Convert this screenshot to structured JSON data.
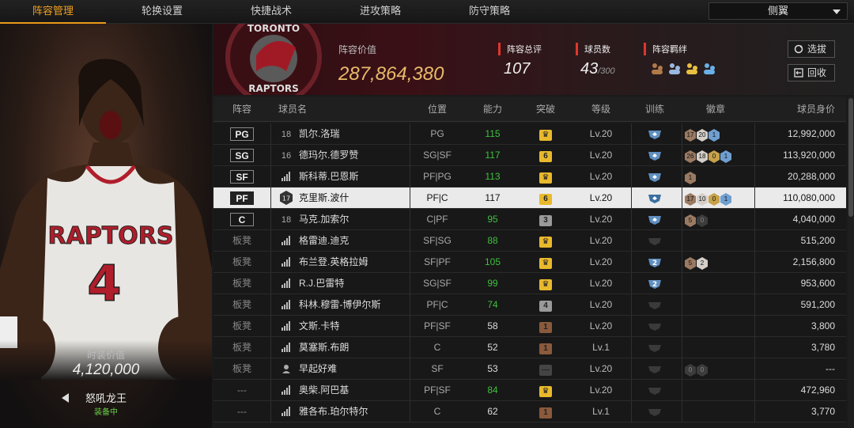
{
  "tabs": [
    "阵容管理",
    "轮换设置",
    "快捷战术",
    "进攻策略",
    "防守策略"
  ],
  "view_select": "侧翼",
  "left_panel": {
    "jersey_team": "RAPTORS",
    "jersey_number": "4",
    "value_label": "时装价值",
    "value": "4,120,000",
    "skin_name": "怒吼龙王",
    "skin_status": "装备中"
  },
  "header": {
    "logo_text_top": "TORONTO",
    "logo_text_bottom": "RAPTORS",
    "lineup_value_label": "阵容价值",
    "lineup_value": "287,864,380",
    "total_rating_label": "阵容总评",
    "total_rating": "107",
    "players_label": "球员数",
    "players_count": "43",
    "players_max": "/300",
    "bond_label": "阵容羁绊",
    "select_button": "选拔",
    "recycle_button": "回收"
  },
  "columns": [
    "阵容",
    "球员名",
    "位置",
    "能力",
    "突破",
    "等级",
    "训练",
    "徽章",
    "球员身价"
  ],
  "rows": [
    {
      "slot": "PG",
      "slot_type": "badge",
      "rank": "18",
      "name": "凯尔.洛瑞",
      "position": "PG",
      "ability": "115",
      "ability_color": "green",
      "breakthrough": "♛",
      "brk_color": "gold",
      "level": "Lv.20",
      "training": "shield",
      "badges": [
        {
          "t": "17",
          "c": "b-brz"
        },
        {
          "t": "20",
          "c": "b-lt"
        },
        {
          "t": "1",
          "c": "b-blue"
        }
      ],
      "value": "12,992,000"
    },
    {
      "slot": "SG",
      "slot_type": "badge",
      "rank": "16",
      "name": "德玛尔.德罗赞",
      "position": "SG|SF",
      "ability": "117",
      "ability_color": "green",
      "breakthrough": "6",
      "brk_color": "gold",
      "level": "Lv.20",
      "training": "shield",
      "badges": [
        {
          "t": "26",
          "c": "b-brz"
        },
        {
          "t": "18",
          "c": "b-lt"
        },
        {
          "t": "0",
          "c": "b-gold"
        },
        {
          "t": "1",
          "c": "b-blue"
        }
      ],
      "value": "113,920,000"
    },
    {
      "slot": "SF",
      "slot_type": "badge",
      "rank": "",
      "name": "斯科蒂.巴恩斯",
      "position": "PF|PG",
      "ability": "113",
      "ability_color": "green",
      "breakthrough": "♛",
      "brk_color": "gold",
      "level": "Lv.20",
      "training": "shield",
      "badges": [
        {
          "t": "1",
          "c": "b-brz"
        }
      ],
      "value": "20,288,000"
    },
    {
      "slot": "PF",
      "slot_type": "badge",
      "rank": "17",
      "name": "克里斯.波什",
      "position": "PF|C",
      "ability": "117",
      "ability_color": "white",
      "breakthrough": "6",
      "brk_color": "gold",
      "level": "Lv.20",
      "training": "shield",
      "badges": [
        {
          "t": "17",
          "c": "b-brz"
        },
        {
          "t": "10",
          "c": "b-lt"
        },
        {
          "t": "0",
          "c": "b-gold"
        },
        {
          "t": "1",
          "c": "b-blue"
        }
      ],
      "value": "110,080,000",
      "selected": true
    },
    {
      "slot": "C",
      "slot_type": "badge",
      "rank": "18",
      "name": "马克.加索尔",
      "position": "C|PF",
      "ability": "95",
      "ability_color": "green",
      "breakthrough": "3",
      "brk_color": "grey",
      "level": "Lv.20",
      "training": "shield",
      "badges": [
        {
          "t": "5",
          "c": "b-brz"
        },
        {
          "t": "0",
          "c": "b-dark"
        }
      ],
      "value": "4,040,000"
    },
    {
      "slot": "板凳",
      "slot_type": "text",
      "rank": "",
      "name": "格雷迪.迪克",
      "position": "SF|SG",
      "ability": "88",
      "ability_color": "green",
      "breakthrough": "♛",
      "brk_color": "gold",
      "level": "Lv.20",
      "training": "dim",
      "badges": [],
      "value": "515,200"
    },
    {
      "slot": "板凳",
      "slot_type": "text",
      "rank": "",
      "name": "布兰登.英格拉姆",
      "position": "SF|PF",
      "ability": "105",
      "ability_color": "green",
      "breakthrough": "♛",
      "brk_color": "gold",
      "level": "Lv.20",
      "training": "2",
      "badges": [
        {
          "t": "5",
          "c": "b-brz"
        },
        {
          "t": "2",
          "c": "b-lt"
        }
      ],
      "value": "2,156,800"
    },
    {
      "slot": "板凳",
      "slot_type": "text",
      "rank": "",
      "name": "R.J.巴雷特",
      "position": "SG|SF",
      "ability": "99",
      "ability_color": "green",
      "breakthrough": "♛",
      "brk_color": "gold",
      "level": "Lv.20",
      "training": "2",
      "badges": [],
      "value": "953,600"
    },
    {
      "slot": "板凳",
      "slot_type": "text",
      "rank": "",
      "name": "科林.穆雷-博伊尔斯",
      "position": "PF|C",
      "ability": "74",
      "ability_color": "green",
      "breakthrough": "4",
      "brk_color": "grey",
      "level": "Lv.20",
      "training": "dim",
      "badges": [],
      "value": "591,200"
    },
    {
      "slot": "板凳",
      "slot_type": "text",
      "rank": "",
      "name": "文斯.卡特",
      "position": "PF|SF",
      "ability": "58",
      "ability_color": "white",
      "breakthrough": "1",
      "brk_color": "brown",
      "level": "Lv.20",
      "training": "dim",
      "badges": [],
      "value": "3,800"
    },
    {
      "slot": "板凳",
      "slot_type": "text",
      "rank": "",
      "name": "莫塞斯.布朗",
      "position": "C",
      "ability": "52",
      "ability_color": "white",
      "breakthrough": "1",
      "brk_color": "brown",
      "level": "Lv.1",
      "training": "dim",
      "badges": [],
      "value": "3,780"
    },
    {
      "slot": "板凳",
      "slot_type": "text",
      "rank": "",
      "name": "早起好难",
      "position": "SF",
      "ability": "53",
      "ability_color": "white",
      "breakthrough": "—",
      "brk_color": "dark",
      "level": "Lv.20",
      "training": "dim",
      "badges": [
        {
          "t": "0",
          "c": "b-dark"
        },
        {
          "t": "0",
          "c": "b-dark"
        }
      ],
      "value": "---",
      "avatar": true
    },
    {
      "slot": "---",
      "slot_type": "text",
      "rank": "",
      "name": "奥柴.阿巴基",
      "position": "PF|SF",
      "ability": "84",
      "ability_color": "green",
      "breakthrough": "♛",
      "brk_color": "gold",
      "level": "Lv.20",
      "training": "dim",
      "badges": [],
      "value": "472,960"
    },
    {
      "slot": "---",
      "slot_type": "text",
      "rank": "",
      "name": "雅各布.珀尔特尔",
      "position": "C",
      "ability": "62",
      "ability_color": "white",
      "breakthrough": "1",
      "brk_color": "brown",
      "level": "Lv.1",
      "training": "dim",
      "badges": [],
      "value": "3,770"
    }
  ]
}
